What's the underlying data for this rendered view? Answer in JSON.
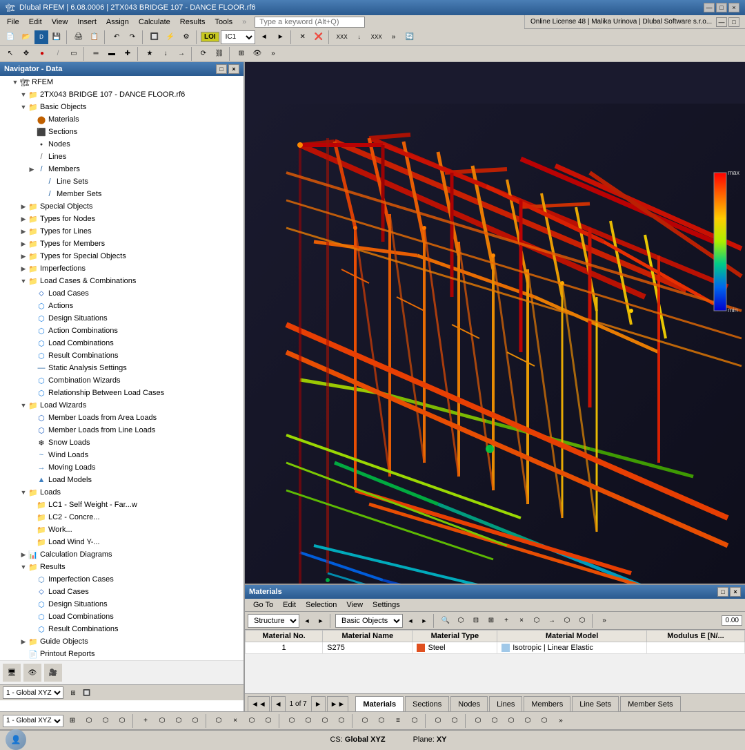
{
  "titleBar": {
    "icon": "🏗",
    "title": "Dlubal RFEM | 6.08.0006 | 2TX043 BRIDGE 107 - DANCE FLOOR.rf6",
    "controls": [
      "—",
      "□",
      "×"
    ]
  },
  "menuBar": {
    "items": [
      "File",
      "Edit",
      "View",
      "Insert",
      "Assign",
      "Calculate",
      "Results",
      "Tools"
    ]
  },
  "onlineBar": {
    "label": "Online License 48 | Malika Urinova | Dlubal Software s.r.o..."
  },
  "searchBox": {
    "placeholder": "Type a keyword (Alt+Q)"
  },
  "navigator": {
    "title": "Navigator - Data",
    "rootLabel": "RFEM",
    "projectLabel": "2TX043 BRIDGE 107 - DANCE FLOOR.rf6",
    "tree": [
      {
        "id": "basic-objects",
        "label": "Basic Objects",
        "level": 1,
        "icon": "folder",
        "expanded": true,
        "toggle": "▼"
      },
      {
        "id": "materials",
        "label": "Materials",
        "level": 2,
        "icon": "mat",
        "toggle": ""
      },
      {
        "id": "sections",
        "label": "Sections",
        "level": 2,
        "icon": "sec",
        "toggle": ""
      },
      {
        "id": "nodes",
        "label": "Nodes",
        "level": 2,
        "icon": "node",
        "toggle": ""
      },
      {
        "id": "lines",
        "label": "Lines",
        "level": 2,
        "icon": "line",
        "toggle": ""
      },
      {
        "id": "members",
        "label": "Members",
        "level": 2,
        "icon": "member",
        "toggle": "▶"
      },
      {
        "id": "line-sets",
        "label": "Line Sets",
        "level": 3,
        "icon": "lineset",
        "toggle": ""
      },
      {
        "id": "member-sets",
        "label": "Member Sets",
        "level": 3,
        "icon": "memberset",
        "toggle": ""
      },
      {
        "id": "special-objects",
        "label": "Special Objects",
        "level": 1,
        "icon": "folder",
        "expanded": false,
        "toggle": "▶"
      },
      {
        "id": "types-nodes",
        "label": "Types for Nodes",
        "level": 1,
        "icon": "folder",
        "expanded": false,
        "toggle": "▶"
      },
      {
        "id": "types-lines",
        "label": "Types for Lines",
        "level": 1,
        "icon": "folder",
        "expanded": false,
        "toggle": "▶"
      },
      {
        "id": "types-members",
        "label": "Types for Members",
        "level": 1,
        "icon": "folder",
        "expanded": false,
        "toggle": "▶"
      },
      {
        "id": "types-special",
        "label": "Types for Special Objects",
        "level": 1,
        "icon": "folder",
        "expanded": false,
        "toggle": "▶"
      },
      {
        "id": "imperfections",
        "label": "Imperfections",
        "level": 1,
        "icon": "folder",
        "expanded": false,
        "toggle": "▶"
      },
      {
        "id": "load-cases-comb",
        "label": "Load Cases & Combinations",
        "level": 1,
        "icon": "folder",
        "expanded": true,
        "toggle": "▼"
      },
      {
        "id": "load-cases",
        "label": "Load Cases",
        "level": 2,
        "icon": "loadcase",
        "toggle": ""
      },
      {
        "id": "actions",
        "label": "Actions",
        "level": 2,
        "icon": "action",
        "toggle": ""
      },
      {
        "id": "design-situations",
        "label": "Design Situations",
        "level": 2,
        "icon": "design",
        "toggle": ""
      },
      {
        "id": "action-combinations",
        "label": "Action Combinations",
        "level": 2,
        "icon": "actioncomb",
        "toggle": ""
      },
      {
        "id": "load-combinations",
        "label": "Load Combinations",
        "level": 2,
        "icon": "loadcomb",
        "toggle": ""
      },
      {
        "id": "result-combinations",
        "label": "Result Combinations",
        "level": 2,
        "icon": "resultcomb",
        "toggle": ""
      },
      {
        "id": "static-analysis",
        "label": "Static Analysis Settings",
        "level": 2,
        "icon": "static",
        "toggle": ""
      },
      {
        "id": "combination-wizards",
        "label": "Combination Wizards",
        "level": 2,
        "icon": "wizard",
        "toggle": ""
      },
      {
        "id": "relationship-load",
        "label": "Relationship Between Load Cases",
        "level": 2,
        "icon": "rel",
        "toggle": ""
      },
      {
        "id": "load-wizards",
        "label": "Load Wizards",
        "level": 1,
        "icon": "folder",
        "expanded": true,
        "toggle": "▼"
      },
      {
        "id": "member-loads-area",
        "label": "Member Loads from Area Loads",
        "level": 2,
        "icon": "membload",
        "toggle": ""
      },
      {
        "id": "member-loads-line",
        "label": "Member Loads from Line Loads",
        "level": 2,
        "icon": "membload2",
        "toggle": ""
      },
      {
        "id": "snow-loads",
        "label": "Snow Loads",
        "level": 2,
        "icon": "snow",
        "toggle": ""
      },
      {
        "id": "wind-loads",
        "label": "Wind Loads",
        "level": 2,
        "icon": "wind",
        "toggle": ""
      },
      {
        "id": "moving-loads",
        "label": "Moving Loads",
        "level": 2,
        "icon": "moving",
        "toggle": ""
      },
      {
        "id": "load-models",
        "label": "Load Models",
        "level": 2,
        "icon": "loadmodel",
        "toggle": ""
      },
      {
        "id": "loads",
        "label": "Loads",
        "level": 1,
        "icon": "folder",
        "expanded": true,
        "toggle": "▼"
      },
      {
        "id": "lc1",
        "label": "LC1 - Self Weight - Far...w",
        "level": 2,
        "icon": "lc1",
        "toggle": ""
      },
      {
        "id": "lc2",
        "label": "LC2 - Concre...",
        "level": 2,
        "icon": "lc2",
        "toggle": ""
      },
      {
        "id": "work",
        "label": "Work...",
        "level": 2,
        "icon": "work",
        "toggle": ""
      },
      {
        "id": "load-wind",
        "label": "Load Wind Y-...",
        "level": 2,
        "icon": "loadwind",
        "toggle": ""
      },
      {
        "id": "calc-diagrams",
        "label": "Calculation Diagrams",
        "level": 1,
        "icon": "diagrams",
        "expanded": false,
        "toggle": "▶"
      },
      {
        "id": "results",
        "label": "Results",
        "level": 1,
        "icon": "folder",
        "expanded": true,
        "toggle": "▼"
      },
      {
        "id": "imperfection-cases",
        "label": "Imperfection Cases",
        "level": 2,
        "icon": "impcases",
        "toggle": ""
      },
      {
        "id": "load-cases-res",
        "label": "Load Cases",
        "level": 2,
        "icon": "loadcaseres",
        "toggle": ""
      },
      {
        "id": "design-situations-res",
        "label": "Design Situations",
        "level": 2,
        "icon": "designres",
        "toggle": ""
      },
      {
        "id": "load-combinations-res",
        "label": "Load Combinations",
        "level": 2,
        "icon": "loadcombres",
        "toggle": ""
      },
      {
        "id": "result-combinations-res",
        "label": "Result Combinations",
        "level": 2,
        "icon": "resultcombres",
        "toggle": ""
      },
      {
        "id": "guide-objects",
        "label": "Guide Objects",
        "level": 1,
        "icon": "folder",
        "expanded": false,
        "toggle": "▶"
      },
      {
        "id": "printout-reports",
        "label": "Printout Reports",
        "level": 1,
        "icon": "printout",
        "toggle": ""
      }
    ]
  },
  "materialsPanel": {
    "title": "Materials",
    "menus": [
      "Go To",
      "Edit",
      "Selection",
      "View",
      "Settings"
    ],
    "dropdowns": {
      "structure": "Structure",
      "basicObjects": "Basic Objects"
    },
    "table": {
      "headers": [
        "Material No.",
        "Material Name",
        "Material Type",
        "Material Model",
        "Modulu E [N/..."
      ],
      "rows": [
        {
          "no": "1",
          "name": "S275",
          "type": "Steel",
          "model": "Isotropic | Linear Elastic",
          "typeColor": "#e05020"
        }
      ]
    },
    "tabs": [
      "Materials",
      "Sections",
      "Nodes",
      "Lines",
      "Members",
      "Line Sets",
      "Member Sets"
    ],
    "activeTab": "Materials",
    "pagination": "1 of 7"
  },
  "statusBar": {
    "item1": "1 - Global XYZ",
    "item2": "CS: Global XYZ",
    "item3": "Plane: XY"
  },
  "loiLabel": "LOI",
  "icLabel": "IC1",
  "icons": {
    "folder": "📁",
    "expand": "▶",
    "collapse": "▼",
    "search": "🔍",
    "settings": "⚙",
    "close": "×",
    "minimize": "—",
    "restore": "□",
    "arrow_left": "◄",
    "arrow_right": "►",
    "arrow_first": "◄◄",
    "arrow_last": "►►"
  }
}
